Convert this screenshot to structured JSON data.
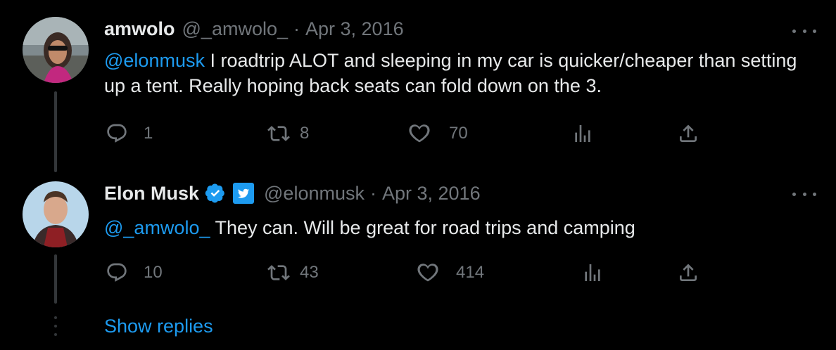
{
  "tweets": [
    {
      "name": "amwolo",
      "handle": "@_amwolo_",
      "separator": "·",
      "date": "Apr 3, 2016",
      "mention": "@elonmusk",
      "text": " I roadtrip ALOT and sleeping in my car is quicker/cheaper than setting up a tent. Really hoping back seats can fold down on the 3.",
      "replies": "1",
      "retweets": "8",
      "likes": "70"
    },
    {
      "name": "Elon Musk",
      "handle": "@elonmusk",
      "separator": "·",
      "date": "Apr 3, 2016",
      "mention": "@_amwolo_",
      "text": " They can. Will be great for road trips and camping",
      "replies": "10",
      "retweets": "43",
      "likes": "414"
    }
  ],
  "show_replies_label": "Show replies",
  "colors": {
    "background": "#000000",
    "text": "#e7e9ea",
    "muted": "#71767b",
    "accent": "#1d9bf0"
  },
  "icons": [
    "reply-icon",
    "retweet-icon",
    "like-icon",
    "views-icon",
    "share-icon",
    "verified-icon",
    "twitter-bird-icon",
    "more-icon"
  ]
}
